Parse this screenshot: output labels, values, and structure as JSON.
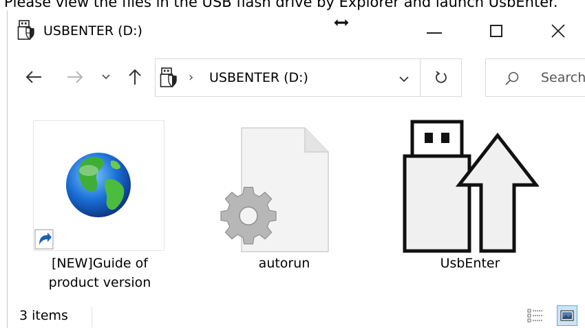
{
  "instruction": {
    "text": "Please view the files in the USB flash drive by Explorer and launch UsbEnter."
  },
  "window": {
    "title": "USBENTER (D:)",
    "icons": {
      "drive": "usb-drive-shield-icon",
      "resize": "horizontal-resize-cursor-icon",
      "minimize": "minimize-icon",
      "maximize": "maximize-icon",
      "close": "close-icon"
    }
  },
  "toolbar": {
    "back_icon": "arrow-left-icon",
    "forward_icon": "arrow-right-icon",
    "recent_icon": "chevron-down-icon",
    "up_icon": "arrow-up-icon",
    "address": {
      "separator": "›",
      "location": "USBENTER (D:)",
      "dropdown_icon": "chevron-down-icon"
    },
    "refresh_icon": "refresh-icon",
    "search": {
      "placeholder": "Search"
    }
  },
  "files": [
    {
      "name": "[NEW]Guide of\nproduct version",
      "line1": "[NEW]Guide of",
      "line2": "product version",
      "icon": "globe-shortcut-icon"
    },
    {
      "name": "autorun",
      "line1": "autorun",
      "icon": "settings-file-icon"
    },
    {
      "name": "UsbEnter",
      "line1": "UsbEnter",
      "icon": "usb-upload-icon"
    }
  ],
  "status": {
    "count": "3 items",
    "details_view_icon": "details-view-icon",
    "large_icons_view_icon": "large-icons-view-icon"
  },
  "colors": {
    "border": "#d9d9d9",
    "selection": "#cce4f7",
    "selection_border": "#66a8e0",
    "shortcut_arrow": "#1e5fb3"
  }
}
